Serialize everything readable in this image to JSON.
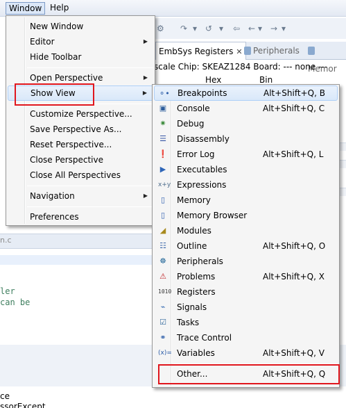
{
  "menubar": {
    "items": [
      "Window",
      "Help"
    ]
  },
  "background": {
    "tabs": [
      {
        "label": "EmbSys Registers",
        "close": "✕"
      },
      {
        "label": "Peripherals"
      },
      {
        "label": "Memor"
      }
    ],
    "info_line": "scale  Chip: SKEAZ1284  Board: ---   none ---",
    "columns": [
      "Hex",
      "Bin"
    ],
    "editor_tab": "n.c",
    "code_lines": [
      "ler",
      "can be"
    ],
    "bottom_lines": [
      "ce",
      "ssorExcept"
    ]
  },
  "window_menu": {
    "items": [
      {
        "label": "New Window",
        "submenu": false
      },
      {
        "label": "Editor",
        "submenu": true
      },
      {
        "label": "Hide Toolbar",
        "submenu": false
      },
      {
        "label": "Open Perspective",
        "submenu": true
      },
      {
        "label": "Show View",
        "submenu": true
      },
      {
        "label": "Customize Perspective...",
        "submenu": false
      },
      {
        "label": "Save Perspective As...",
        "submenu": false
      },
      {
        "label": "Reset Perspective...",
        "submenu": false
      },
      {
        "label": "Close Perspective",
        "submenu": false
      },
      {
        "label": "Close All Perspectives",
        "submenu": false
      },
      {
        "label": "Navigation",
        "submenu": true
      },
      {
        "label": "Preferences",
        "submenu": false
      }
    ]
  },
  "show_view_menu": {
    "items": [
      {
        "label": "Breakpoints",
        "accel": "Alt+Shift+Q, B",
        "icon": "breakpoints-icon",
        "glyph": "⚬•",
        "color": "#2b5ca8"
      },
      {
        "label": "Console",
        "accel": "Alt+Shift+Q, C",
        "icon": "console-icon",
        "glyph": "▣",
        "color": "#2e5e9c"
      },
      {
        "label": "Debug",
        "accel": "",
        "icon": "debug-icon",
        "glyph": "✷",
        "color": "#3a8a3a"
      },
      {
        "label": "Disassembly",
        "accel": "",
        "icon": "disassembly-icon",
        "glyph": "☰",
        "color": "#3555a5"
      },
      {
        "label": "Error Log",
        "accel": "Alt+Shift+Q, L",
        "icon": "error-log-icon",
        "glyph": "❗",
        "color": "#c0282d"
      },
      {
        "label": "Executables",
        "accel": "",
        "icon": "executables-icon",
        "glyph": "▶",
        "color": "#2f66b8"
      },
      {
        "label": "Expressions",
        "accel": "",
        "icon": "expressions-icon",
        "glyph": "x+y",
        "color": "#4a6a8a"
      },
      {
        "label": "Memory",
        "accel": "",
        "icon": "memory-icon",
        "glyph": "▯",
        "color": "#2f5fb0"
      },
      {
        "label": "Memory Browser",
        "accel": "",
        "icon": "memory-browser-icon",
        "glyph": "▯",
        "color": "#2f5fb0"
      },
      {
        "label": "Modules",
        "accel": "",
        "icon": "modules-icon",
        "glyph": "◢",
        "color": "#a88a1e"
      },
      {
        "label": "Outline",
        "accel": "Alt+Shift+Q, O",
        "icon": "outline-icon",
        "glyph": "☷",
        "color": "#3563a8"
      },
      {
        "label": "Peripherals",
        "accel": "",
        "icon": "peripherals-icon",
        "glyph": "☸",
        "color": "#2e6f9e"
      },
      {
        "label": "Problems",
        "accel": "Alt+Shift+Q, X",
        "icon": "problems-icon",
        "glyph": "⚠",
        "color": "#c0282d"
      },
      {
        "label": "Registers",
        "accel": "",
        "icon": "registers-icon",
        "glyph": "01",
        "color": "#333333"
      },
      {
        "label": "Signals",
        "accel": "",
        "icon": "signals-icon",
        "glyph": "⌁",
        "color": "#3b6fb5"
      },
      {
        "label": "Tasks",
        "accel": "",
        "icon": "tasks-icon",
        "glyph": "☑",
        "color": "#3a6ea0"
      },
      {
        "label": "Trace Control",
        "accel": "",
        "icon": "trace-control-icon",
        "glyph": "⚭",
        "color": "#2b5ca8"
      },
      {
        "label": "Variables",
        "accel": "Alt+Shift+Q, V",
        "icon": "variables-icon",
        "glyph": "(x)=",
        "color": "#2b5ca8"
      },
      {
        "label": "Other...",
        "accel": "Alt+Shift+Q, Q",
        "icon": "other-icon",
        "glyph": "",
        "color": "#000000"
      }
    ]
  }
}
